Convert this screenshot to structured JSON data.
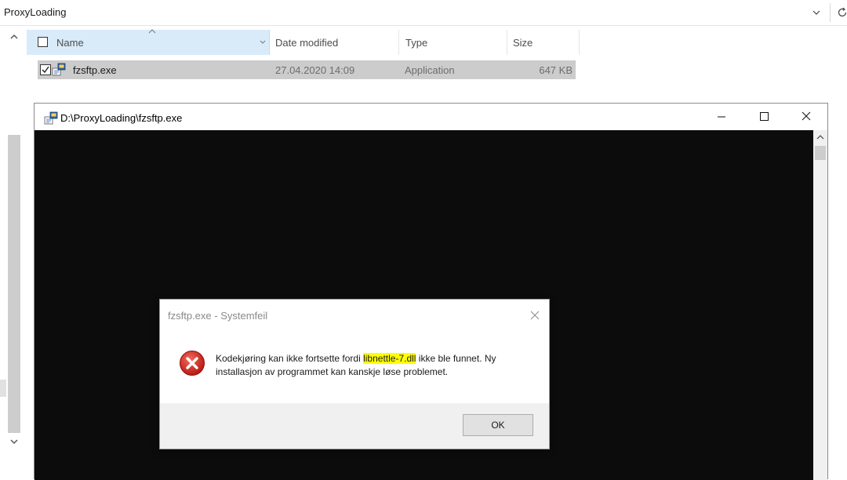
{
  "explorer": {
    "address": "ProxyLoading",
    "columns": {
      "name": "Name",
      "date_modified": "Date modified",
      "type": "Type",
      "size": "Size"
    },
    "files": [
      {
        "name": "fzsftp.exe",
        "date_modified": "27.04.2020 14:09",
        "type": "Application",
        "size": "647 KB",
        "checked": true
      }
    ]
  },
  "console": {
    "title": "D:\\ProxyLoading\\fzsftp.exe",
    "background": "#0c0c0c"
  },
  "dialog": {
    "title": "fzsftp.exe - Systemfeil",
    "message_before": "Kodekjøring kan ikke fortsette fordi ",
    "message_highlight": "libnettle-7.dll",
    "message_after_line1": " ikke ble funnet. Ny",
    "message_line2": "installasjon av programmet kan kanskje løse problemet.",
    "ok_label": "OK",
    "highlight_color": "#ffff00",
    "error_icon_color": "#c42b1c"
  }
}
